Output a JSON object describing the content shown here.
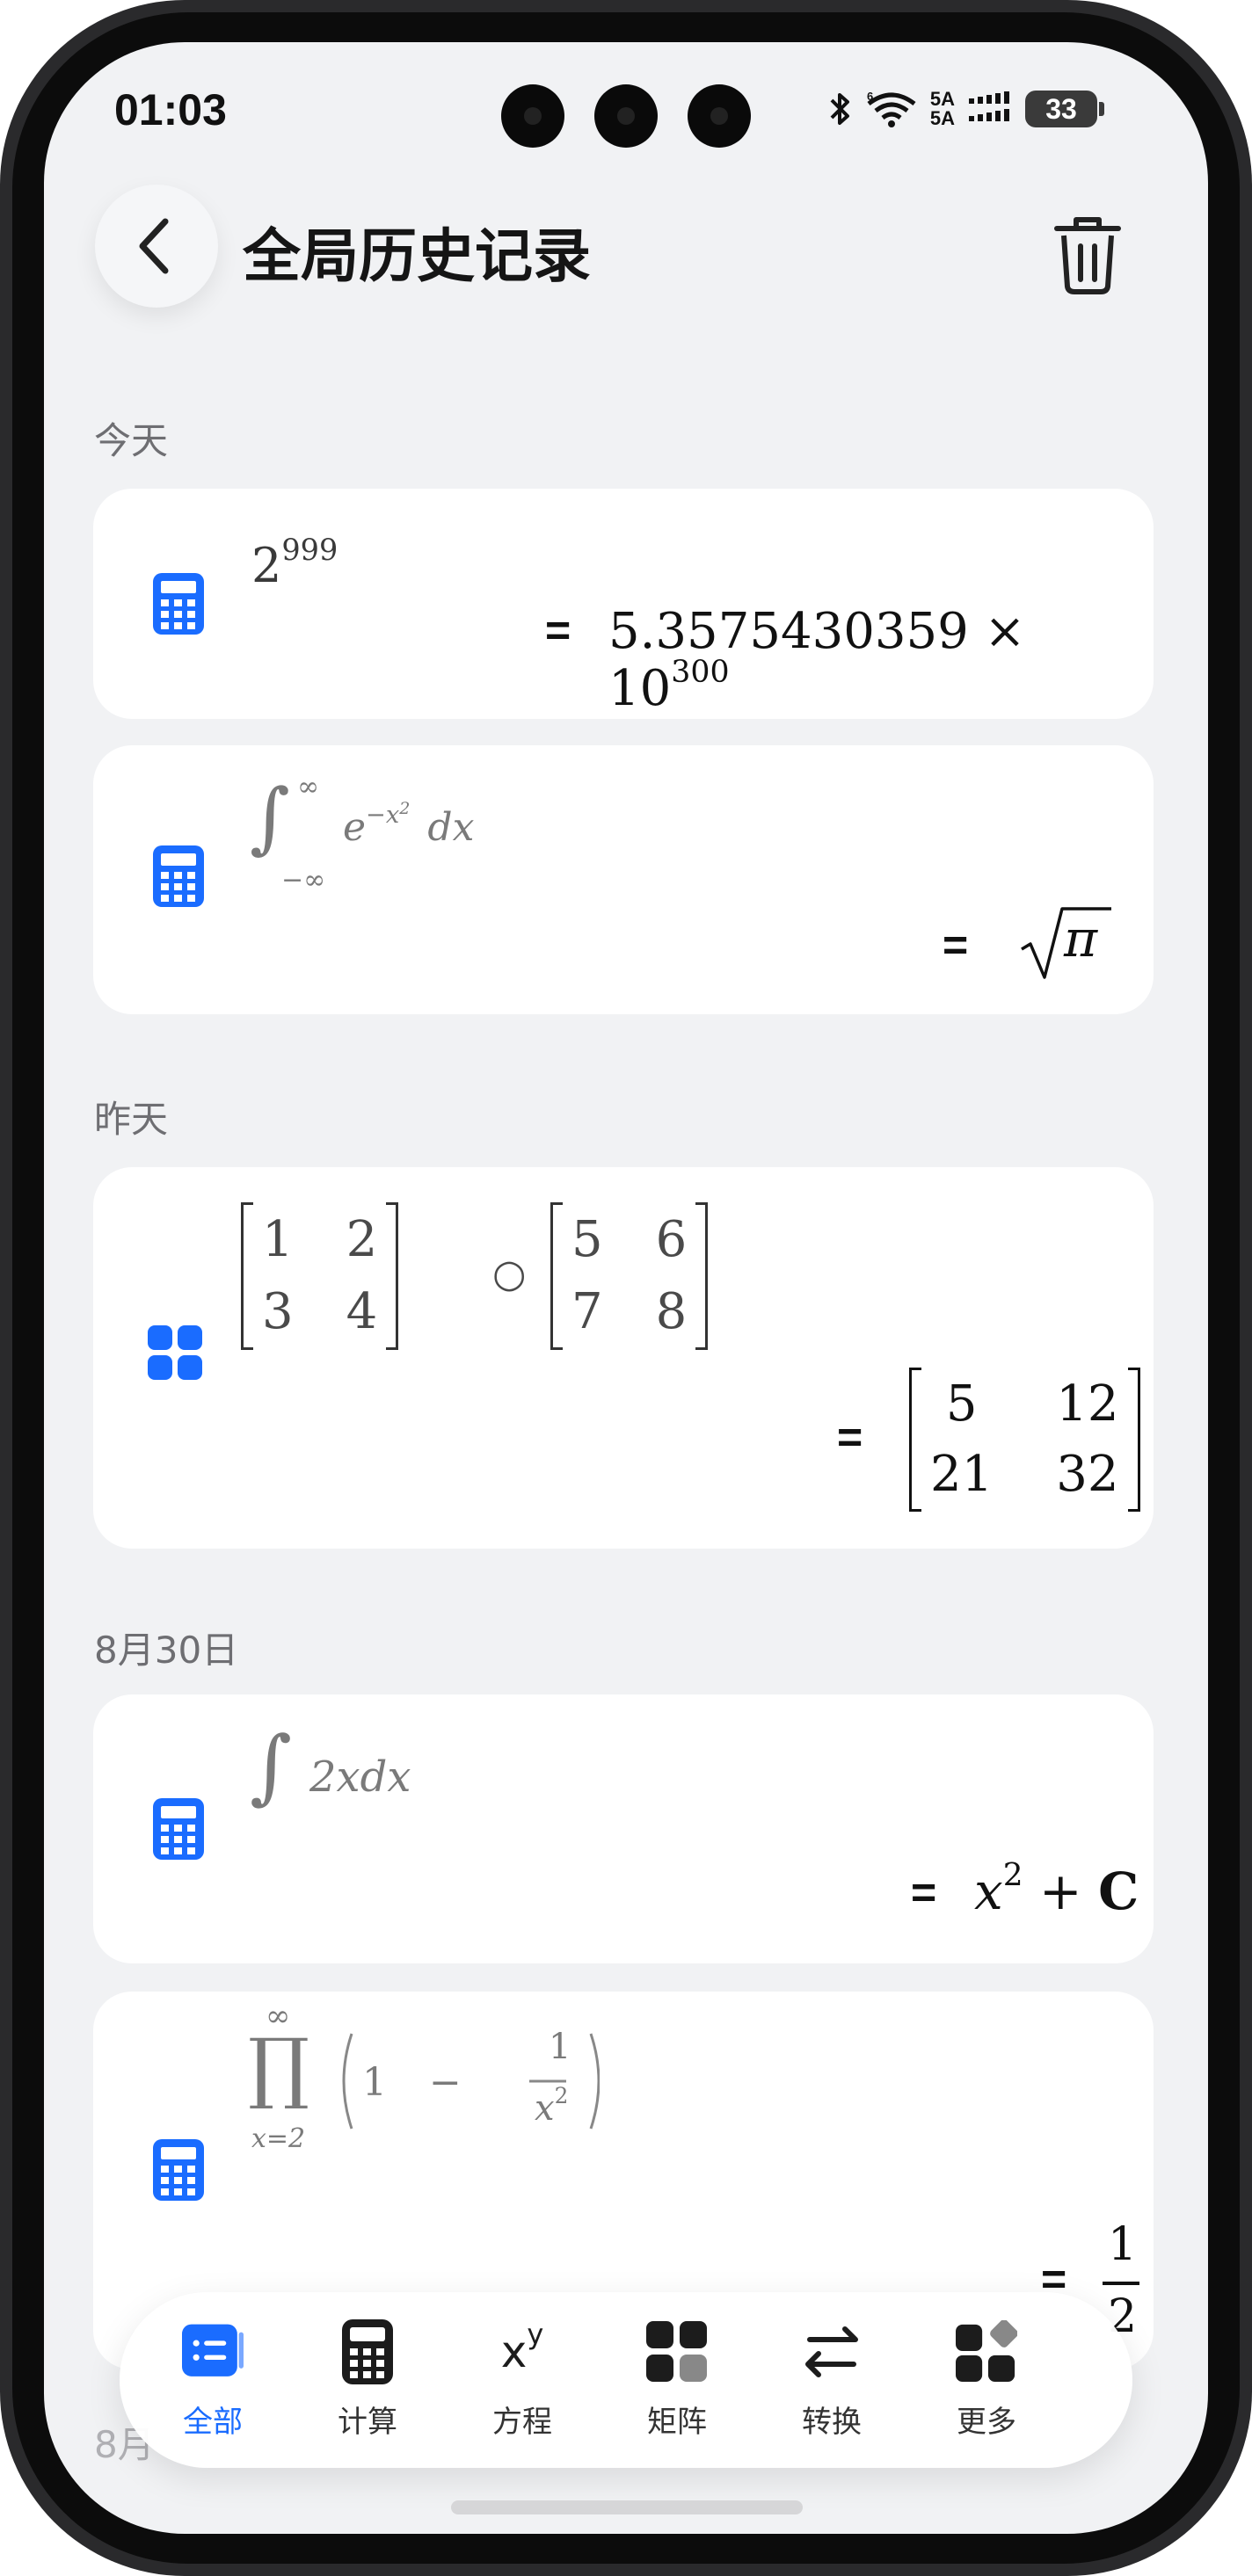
{
  "status_bar": {
    "time": "01:03",
    "network_top": "5A",
    "network_bottom": "5A",
    "battery": "33"
  },
  "header": {
    "title": "全局历史记录"
  },
  "sections": [
    {
      "label": "今天",
      "cards": [
        {
          "icon": "calculator-icon",
          "expression": "2^999",
          "result": "5.3575430359 × 10^300"
        },
        {
          "icon": "calculator-icon",
          "expression": "∫_{-∞}^{∞} e^{-x²} dx",
          "result": "√π"
        }
      ]
    },
    {
      "label": "昨天",
      "cards": [
        {
          "icon": "grid-icon",
          "expression": "[[1,2],[3,4]] ∘ [[5,6],[7,8]]",
          "result": "[[5,12],[21,32]]"
        }
      ]
    },
    {
      "label": "8月30日",
      "cards": [
        {
          "icon": "calculator-icon",
          "expression": "∫ 2x dx",
          "result": "x² + C"
        },
        {
          "icon": "calculator-icon",
          "expression": "∏_{x=2}^{∞} (1 − 1/x²)",
          "result": "1/2"
        }
      ]
    },
    {
      "label": "8月"
    }
  ],
  "math": {
    "c1": {
      "base": "2",
      "exp": "999",
      "res_mant": "5.3575430359",
      "res_times": "×",
      "res_base": "10",
      "res_exp": "300"
    },
    "c2": {
      "int": "∫",
      "upper": "∞",
      "lower": "−∞",
      "e": "e",
      "exp": "−x",
      "exp2": "2",
      "dx": "dx",
      "res": "π"
    },
    "c3": {
      "a": [
        "1",
        "2",
        "3",
        "4"
      ],
      "op": "○",
      "b": [
        "5",
        "6",
        "7",
        "8"
      ],
      "r": [
        "5",
        "12",
        "21",
        "32"
      ]
    },
    "c4": {
      "int": "∫",
      "body": "2xdx",
      "res_x": "x",
      "res_exp": "2",
      "res_plus": "+",
      "res_c": "C"
    },
    "c5": {
      "prod": "∏",
      "upper": "∞",
      "lower": "x=2",
      "one": "1",
      "minus": "−",
      "num": "1",
      "den": "x",
      "den_exp": "2",
      "res_num": "1",
      "res_den": "2"
    },
    "equals": "="
  },
  "bottom_nav": [
    {
      "label": "全部",
      "icon": "list-icon",
      "active": true
    },
    {
      "label": "计算",
      "icon": "calculator-icon",
      "active": false
    },
    {
      "label": "方程",
      "icon": "xy-icon",
      "active": false,
      "glyph_x": "x",
      "glyph_y": "y"
    },
    {
      "label": "矩阵",
      "icon": "matrix-icon",
      "active": false
    },
    {
      "label": "转换",
      "icon": "swap-icon",
      "active": false
    },
    {
      "label": "更多",
      "icon": "more-icon",
      "active": false
    }
  ],
  "colors": {
    "accent": "#1a6cff",
    "background": "#f1f2f4",
    "card": "#ffffff",
    "label": "#6e6e72"
  }
}
